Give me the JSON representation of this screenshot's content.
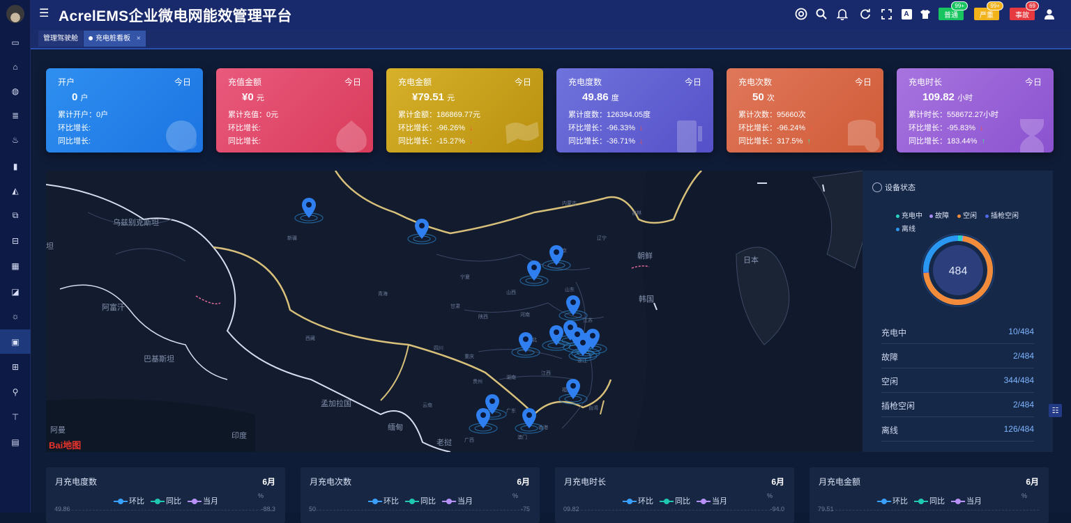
{
  "app": {
    "title": "AcrelEMS企业微电网能效管理平台"
  },
  "header": {
    "buttons": [
      {
        "label": "普通",
        "count": "99+",
        "color": "#17c45f"
      },
      {
        "label": "严重",
        "count": "99+",
        "color": "#f2b21a"
      },
      {
        "label": "事故",
        "count": "69",
        "color": "#e5393f"
      }
    ]
  },
  "tabs": [
    {
      "label": "管理驾驶舱"
    },
    {
      "label": "充电桩看板",
      "close": "×"
    }
  ],
  "cards": [
    {
      "title": "开户",
      "today": "今日",
      "value": "0",
      "unit": "户",
      "line1": "累计开户：0户",
      "line2": "环比增长:",
      "line3": "同比增长:",
      "color1": "#2f8ff0",
      "color2": "#1c74e2"
    },
    {
      "title": "充值金额",
      "today": "今日",
      "value": "¥0",
      "unit": "元",
      "line1": "累计充值：0元",
      "line2": "环比增长:",
      "line3": "同比增长:",
      "color1": "#e95a7c",
      "color2": "#d93b5b"
    },
    {
      "title": "充电金额",
      "today": "今日",
      "value": "¥79.51",
      "unit": "元",
      "line1": "累计金额：186869.77元",
      "line2": "环比增长：-96.26%",
      "line3": "同比增长：-15.27%",
      "trend2": "down",
      "trend3": "down",
      "color1": "#d7b12a",
      "color2": "#b8900f"
    },
    {
      "title": "充电度数",
      "today": "今日",
      "value": "49.86",
      "unit": "度",
      "line1": "累计度数：126394.05度",
      "line2": "环比增长：-96.33%",
      "line3": "同比增长：-36.71%",
      "trend2": "down",
      "trend3": "down",
      "color1": "#6f73dc",
      "color2": "#5550c8"
    },
    {
      "title": "充电次数",
      "today": "今日",
      "value": "50",
      "unit": "次",
      "line1": "累计次数：95660次",
      "line2": "环比增长：-96.24%",
      "line3": "同比增长：317.5%",
      "trend2": "down",
      "trend3": "up",
      "color1": "#e0775a",
      "color2": "#cf5b37"
    },
    {
      "title": "充电时长",
      "today": "今日",
      "value": "109.82",
      "unit": "小时",
      "line1": "累计时长：558672.27小时",
      "line2": "环比增长：-95.83%",
      "line3": "同比增长：183.44%",
      "trend2": "down",
      "trend3": "up",
      "color1": "#a774df",
      "color2": "#8b52cf"
    }
  ],
  "map": {
    "logo": "Bai地图",
    "labels": [
      "乌兹别克斯坦",
      "新疆",
      "内蒙古",
      "吉林",
      "辽宁",
      "朝鲜",
      "日本",
      "韩国",
      "北京",
      "山西",
      "山东",
      "河南",
      "江苏",
      "宁夏",
      "甘肃",
      "陕西",
      "青海",
      "四川",
      "重庆",
      "湖北",
      "湖南",
      "江西",
      "浙江",
      "福建",
      "西藏",
      "贵州",
      "广东",
      "云南",
      "广西",
      "台湾",
      "阿富汗",
      "巴基斯坦",
      "印度",
      "缅甸",
      "孟加拉国",
      "老挝",
      "澳门",
      "香港",
      "阿曼",
      "坦"
    ]
  },
  "status": {
    "title": "设备状态",
    "legend": [
      {
        "label": "充电中",
        "color": "#27d3c4"
      },
      {
        "label": "故障",
        "color": "#a88ef5"
      },
      {
        "label": "空闲",
        "color": "#f28c3b"
      },
      {
        "label": "插枪空闲",
        "color": "#4f68e8"
      },
      {
        "label": "离线",
        "color": "#2a98f2"
      }
    ],
    "total": "484",
    "rows": [
      {
        "label": "充电中",
        "value": "10/484"
      },
      {
        "label": "故障",
        "value": "2/484"
      },
      {
        "label": "空闲",
        "value": "344/484"
      },
      {
        "label": "插枪空闲",
        "value": "2/484"
      },
      {
        "label": "离线",
        "value": "126/484"
      }
    ]
  },
  "monthly": [
    {
      "title": "月充电度数",
      "month": "6月",
      "left": "49.86",
      "right": "-88.3"
    },
    {
      "title": "月充电次数",
      "month": "6月",
      "left": "50",
      "right": "-75"
    },
    {
      "title": "月充电时长",
      "month": "6月",
      "left": "09.82",
      "right": "-94.0"
    },
    {
      "title": "月充电金额",
      "month": "6月",
      "left": "79.51",
      "right": ""
    }
  ],
  "monthly_legend": {
    "items": [
      {
        "label": "环比",
        "color": "#3aa0ff"
      },
      {
        "label": "同比",
        "color": "#1fc9b0"
      },
      {
        "label": "当月",
        "color": "#b690f5"
      }
    ],
    "pct": "%"
  }
}
